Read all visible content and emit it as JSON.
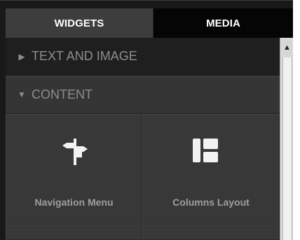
{
  "tabs": [
    {
      "label": "WIDGETS",
      "active": true
    },
    {
      "label": "MEDIA",
      "active": false
    }
  ],
  "sections": [
    {
      "label": "TEXT AND IMAGE",
      "expanded": false,
      "icon": "triangle-right-icon"
    },
    {
      "label": "CONTENT",
      "expanded": true,
      "icon": "triangle-down-icon"
    }
  ],
  "widgets": [
    {
      "label": "Navigation Menu",
      "icon": "signpost-icon"
    },
    {
      "label": "Columns Layout",
      "icon": "columns-layout-icon"
    }
  ],
  "scrollbar": {
    "up_arrow": "▲",
    "position_label": "top"
  },
  "colors": {
    "dark_background": "#191919",
    "active_tab": "#3d3d3d",
    "inactive_tab": "#050505",
    "section_text": "#8d8d8d",
    "widget_label": "#9e9e9e",
    "icon": "#f2f2f2"
  }
}
